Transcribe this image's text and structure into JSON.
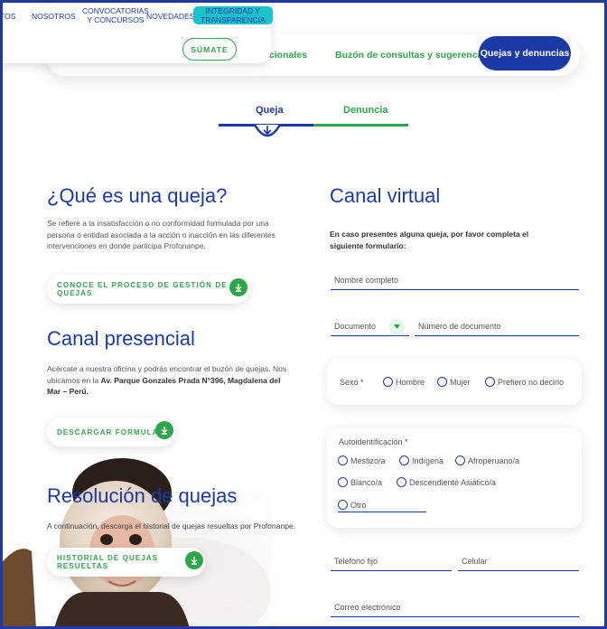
{
  "nav": {
    "items": [
      "TOS",
      "NOSOTROS",
      "CONVOCATORIAS\nY CONCURSOS",
      "NOVEDADES",
      "INTEGRIDAD Y\nTRANSPARENCIA"
    ],
    "sumate_label": "SÚMATE"
  },
  "tabs": {
    "items": [
      "tucionales",
      "Buzón de consultas y sugerencias",
      "Quejas y denuncias"
    ]
  },
  "switch": {
    "queja": "Queja",
    "denuncia": "Denuncia"
  },
  "left": {
    "queja_title": "¿Qué es una queja?",
    "queja_text": "Se refiere a la insatisfacción o no conformidad formulada por una persona o entidad asociada a la acción o inacción en las diferentes intervenciones en donde participa Profonanpe.",
    "queja_button": "CONOCE EL PROCESO DE GESTIÓN DE QUEJAS",
    "presencial_title": "Canal presencial",
    "presencial_text_1": "Acércate a nuestra oficina y podrás encontrar el buzón de quejas. Nos ubicamos en la",
    "presencial_text_bold": "Av. Parque Gonzales Prada N°396, Magdalena del Mar – Perú.",
    "presencial_button": "DESCARGAR FORMULARIO",
    "resolucion_title": "Resolución de quejas",
    "resolucion_text": "A continuación, descarga el historial de quejas resueltas por Profonanpe.",
    "resolucion_button": "HISTORIAL DE QUEJAS RESUELTAS"
  },
  "form": {
    "title": "Canal virtual",
    "intro": "En caso presentes alguna queja, por favor completa el siguiente formulario:",
    "nombre": "Nombre completo",
    "documento": "Documento",
    "numero_documento": "Número de documento",
    "sexo_label": "Sexo *",
    "sexo_options": [
      "Hombre",
      "Mujer",
      "Prefiero no decirlo"
    ],
    "auto_label": "Autoidentificación *",
    "auto_options": [
      "Mestizo/a",
      "Indígena",
      "Afroperuano/a",
      "Blanco/a",
      "Descendiente Asiático/a",
      "Otro"
    ],
    "telefono": "Teléfono fijo",
    "celular": "Celular",
    "correo": "Correo electrónico"
  },
  "colors": {
    "primary": "#1c3aa6",
    "accent": "#2ea74b",
    "highlight": "#1cc2c9"
  }
}
